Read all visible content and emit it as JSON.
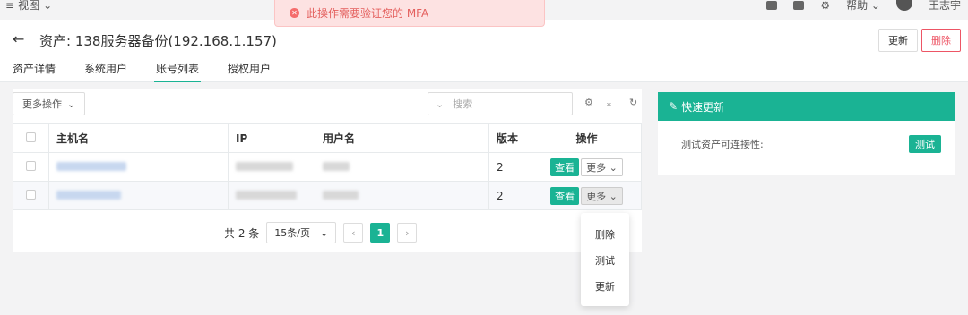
{
  "topbar": {
    "view_label": "视图",
    "help_label": "帮助",
    "user_name": "王志宇"
  },
  "toast": {
    "message": "此操作需要验证您的 MFA"
  },
  "header": {
    "title": "资产: 138服务器备份(192.168.1.157)",
    "update_label": "更新",
    "delete_label": "删除"
  },
  "tabs": [
    {
      "label": "资产详情"
    },
    {
      "label": "系统用户"
    },
    {
      "label": "账号列表"
    },
    {
      "label": "授权用户"
    }
  ],
  "toolbar": {
    "more_ops_label": "更多操作",
    "search_placeholder": "搜索"
  },
  "table": {
    "headers": [
      "主机名",
      "IP",
      "用户名",
      "版本",
      "操作"
    ],
    "rows": [
      {
        "version": "2",
        "view_label": "查看",
        "more_label": "更多"
      },
      {
        "version": "2",
        "view_label": "查看",
        "more_label": "更多"
      }
    ]
  },
  "pagination": {
    "total_label": "共 2 条",
    "page_size": "15条/页",
    "current_page": "1"
  },
  "dropdown": {
    "items": [
      "删除",
      "测试",
      "更新"
    ]
  },
  "quick_update": {
    "title": "快速更新",
    "test_label": "测试资产可连接性:",
    "test_button": "测试"
  },
  "colors": {
    "accent": "#1ab394",
    "danger": "#ed5565",
    "toast_bg": "#fde2e2"
  }
}
